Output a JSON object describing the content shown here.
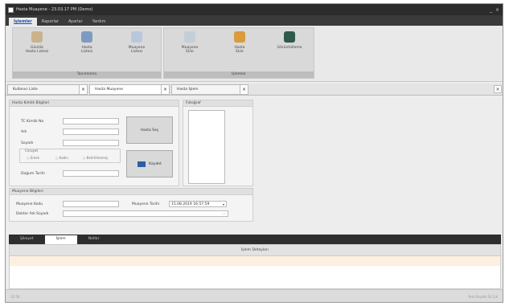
{
  "window": {
    "title": "Hasta Muayene - 23.03.17 PM (Demo)"
  },
  "menu_tabs": [
    "İşlemler",
    "Raporlar",
    "Ayarlar",
    "Yardım"
  ],
  "ribbon": {
    "groups": [
      "Tanımlama",
      "İşlemler"
    ],
    "buttons": [
      {
        "label": "Günlük\nHasta Listesi"
      },
      {
        "label": "Hasta\nListesi"
      },
      {
        "label": "Muayene\nListesi"
      },
      {
        "label": "Muayene\nEkle"
      },
      {
        "label": "Hasta\nEkle"
      },
      {
        "label": "Görüntülleme"
      }
    ]
  },
  "doc_tabs": [
    "Kullanıcı Liste",
    "Hasta Muayene",
    "Hasta İşlem"
  ],
  "hasta_panel": {
    "title": "Hasta Kimlik Bilgileri",
    "fields": [
      "TC Kimlik No",
      "Adı",
      "Soyadı",
      "Doğum Tarihi"
    ],
    "cinsiyet": {
      "title": "Cinsiyet",
      "options": [
        "Erkek",
        "Kadın",
        "Belirtilmemiş"
      ]
    },
    "btn_sec": "Hasta Seç",
    "btn_kaydet": "Kaydet"
  },
  "foto_panel": {
    "title": "Fotoğraf"
  },
  "muayene_panel": {
    "title": "Muayene Bilgileri",
    "kodu_label": "Muayene Kodu",
    "tarih_label": "Muayene Tarihi",
    "tarih_value": "15.08.2019 16:57:59",
    "doktor_label": "Doktor Adı Soyadı"
  },
  "bottom_tabs": [
    "Şikayet",
    "İşlem",
    "Notlar"
  ],
  "grid": {
    "header": "İşlem Detayları"
  },
  "status": {
    "left": "12:54",
    "right": "Yeni  Kaydet  Sil  Çık"
  }
}
